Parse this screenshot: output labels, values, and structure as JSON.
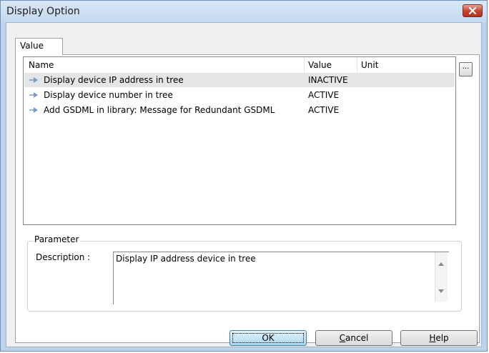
{
  "window": {
    "title": "Display Option"
  },
  "tabs": [
    {
      "label": "Value"
    }
  ],
  "list": {
    "columns": {
      "name": "Name",
      "value": "Value",
      "unit": "Unit"
    },
    "rows": [
      {
        "name": "Display device IP address in tree",
        "value": "INACTIVE",
        "unit": ""
      },
      {
        "name": "Display device number in tree",
        "value": "ACTIVE",
        "unit": ""
      },
      {
        "name": "Add GSDML in library: Message for Redundant GSDML",
        "value": "ACTIVE",
        "unit": ""
      }
    ],
    "browse_label": "..."
  },
  "parameter": {
    "group_title": "Parameter",
    "description_label": "Description :",
    "description_text": "Display IP address device in tree"
  },
  "buttons": {
    "ok": "OK",
    "cancel_mnemonic": "C",
    "cancel_rest": "ancel",
    "help_mnemonic": "H",
    "help_rest": "elp"
  }
}
